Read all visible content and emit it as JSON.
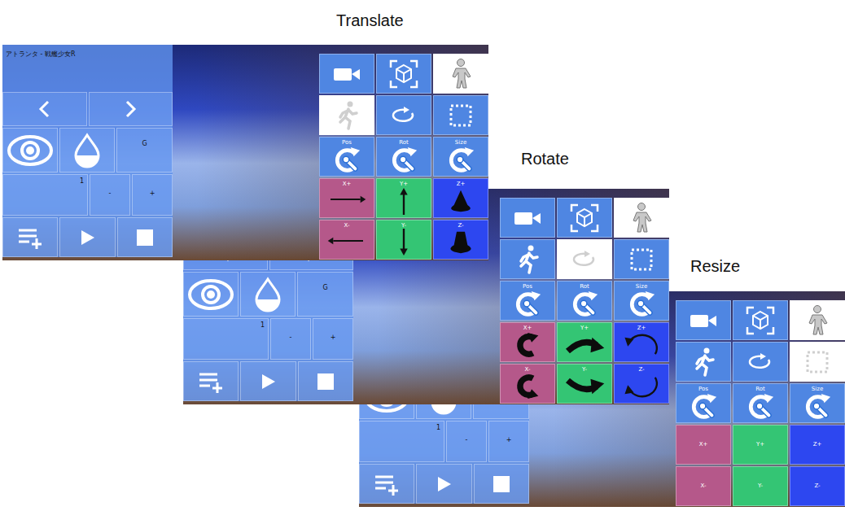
{
  "panels": [
    {
      "caption": "Translate",
      "kind": "translate",
      "title": "アトランタ - 戦艦少女R",
      "g": "G",
      "count": "1",
      "minus": "-",
      "plus": "+",
      "tools": [
        {
          "kind": "camera",
          "selected": false
        },
        {
          "kind": "object",
          "selected": false
        },
        {
          "kind": "model",
          "selected": true
        },
        {
          "kind": "pose",
          "selected": true
        },
        {
          "kind": "rotate",
          "selected": false
        },
        {
          "kind": "scale",
          "selected": false
        }
      ],
      "gizmos": [
        {
          "label": "Pos"
        },
        {
          "label": "Rot"
        },
        {
          "label": "Size"
        }
      ],
      "axes": [
        {
          "label": "X+",
          "color": "#b5588a"
        },
        {
          "label": "Y+",
          "color": "#34c574"
        },
        {
          "label": "Z+",
          "color": "#2d47f0"
        },
        {
          "label": "X-",
          "color": "#b5588a"
        },
        {
          "label": "Y-",
          "color": "#34c574"
        },
        {
          "label": "Z-",
          "color": "#2d47f0"
        }
      ]
    },
    {
      "caption": "Rotate",
      "kind": "rotate",
      "g": "G",
      "count": "1",
      "minus": "-",
      "plus": "+",
      "tools": [
        {
          "kind": "camera",
          "selected": false
        },
        {
          "kind": "object",
          "selected": false
        },
        {
          "kind": "model",
          "selected": true
        },
        {
          "kind": "pose",
          "selected": false
        },
        {
          "kind": "rotate",
          "selected": true
        },
        {
          "kind": "scale",
          "selected": false
        }
      ],
      "gizmos": [
        {
          "label": "Pos"
        },
        {
          "label": "Rot"
        },
        {
          "label": "Size"
        }
      ],
      "axes": [
        {
          "label": "X+",
          "color": "#b5588a"
        },
        {
          "label": "Y+",
          "color": "#34c574"
        },
        {
          "label": "Z+",
          "color": "#2d47f0"
        },
        {
          "label": "X-",
          "color": "#b5588a"
        },
        {
          "label": "Y-",
          "color": "#34c574"
        },
        {
          "label": "Z-",
          "color": "#2d47f0"
        }
      ]
    },
    {
      "caption": "Resize",
      "kind": "resize",
      "count": "1",
      "minus": "-",
      "plus": "+",
      "tools": [
        {
          "kind": "camera",
          "selected": false
        },
        {
          "kind": "object",
          "selected": false
        },
        {
          "kind": "model",
          "selected": true
        },
        {
          "kind": "pose",
          "selected": false
        },
        {
          "kind": "rotate",
          "selected": false
        },
        {
          "kind": "scale",
          "selected": true
        }
      ],
      "gizmos": [
        {
          "label": "Pos"
        },
        {
          "label": "Rot"
        },
        {
          "label": "Size"
        }
      ],
      "axes": [
        {
          "label": "X+",
          "color": "#b5588a"
        },
        {
          "label": "Y+",
          "color": "#34c574"
        },
        {
          "label": "Z+",
          "color": "#2d47f0"
        },
        {
          "label": "X-",
          "color": "#b5588a"
        },
        {
          "label": "Y-",
          "color": "#34c574"
        },
        {
          "label": "Z-",
          "color": "#2d47f0"
        }
      ]
    }
  ]
}
